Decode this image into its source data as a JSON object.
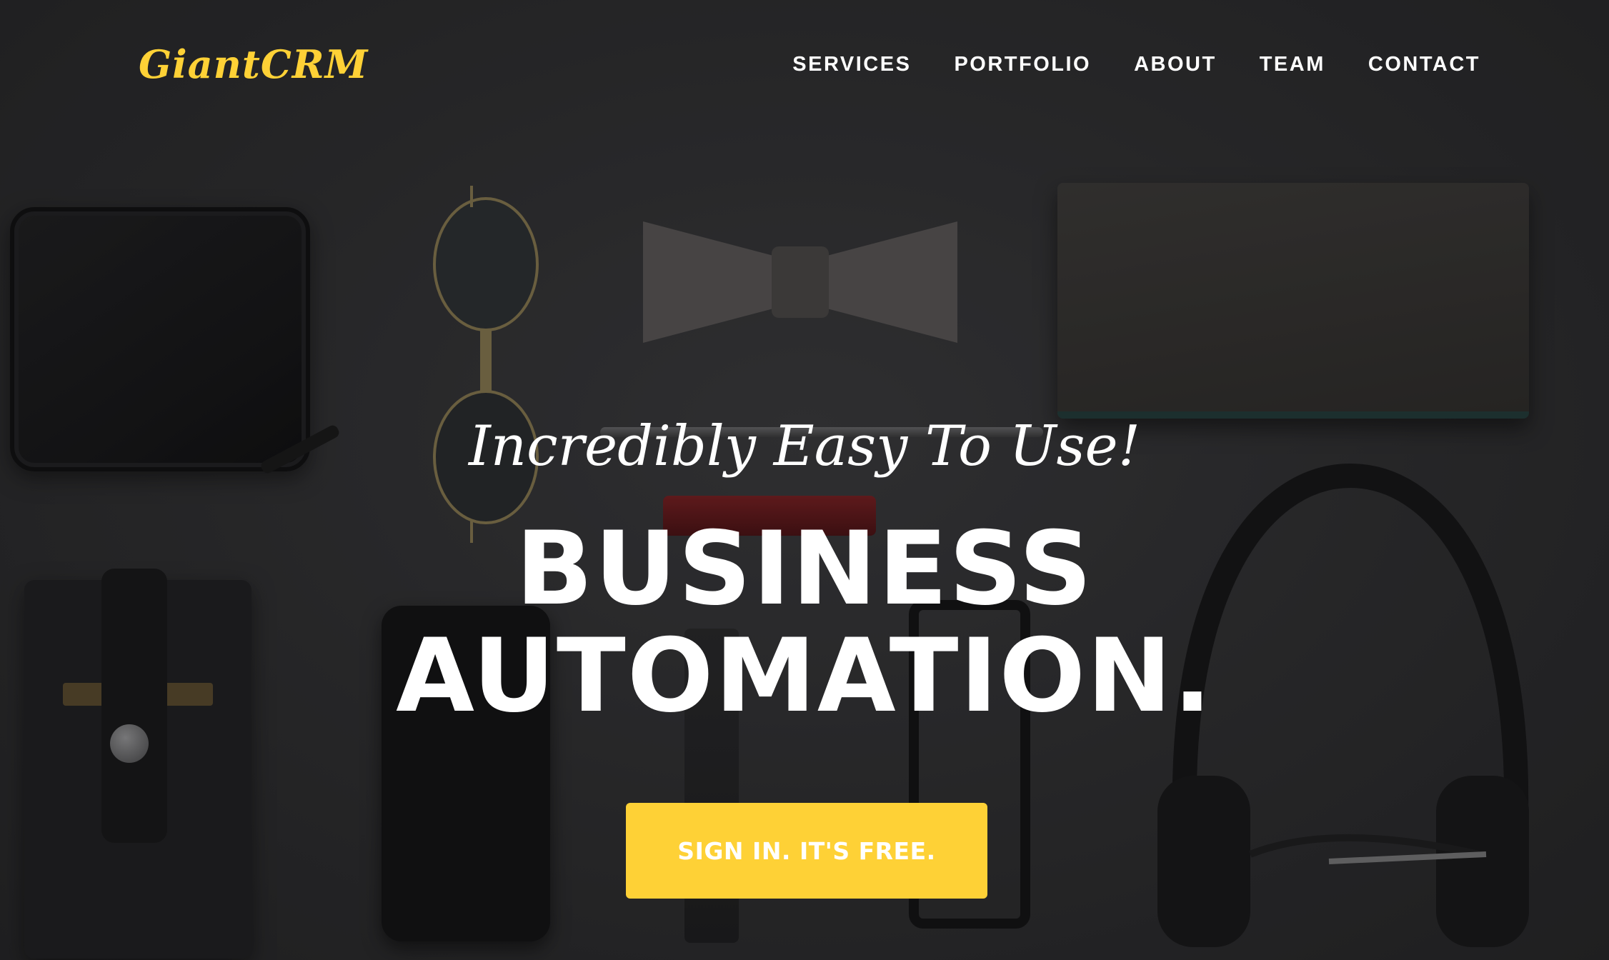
{
  "brand": {
    "logo_text": "GiantCRM",
    "accent_color": "#fed136"
  },
  "nav": {
    "items": [
      {
        "label": "SERVICES"
      },
      {
        "label": "PORTFOLIO"
      },
      {
        "label": "ABOUT"
      },
      {
        "label": "TEAM"
      },
      {
        "label": "CONTACT"
      }
    ]
  },
  "hero": {
    "lead_in": "Incredibly Easy To Use!",
    "heading_line_1": "BUSINESS",
    "heading_line_2": "AUTOMATION.",
    "cta_label": "SIGN IN. IT'S FREE."
  }
}
